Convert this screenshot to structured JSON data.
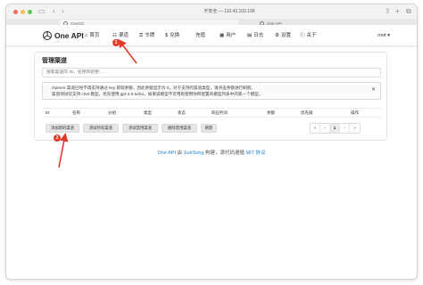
{
  "browser": {
    "address": "不安全 — 110.42.103.199",
    "tabs": [
      {
        "label": "OneOS"
      },
      {
        "label": "One API"
      }
    ]
  },
  "header": {
    "brand": "One API",
    "nav": [
      {
        "label": "首页",
        "icon": "home-icon",
        "glyph": "⌂"
      },
      {
        "label": "渠道",
        "icon": "sitemap-icon",
        "glyph": "☷"
      },
      {
        "label": "令牌",
        "icon": "key-icon",
        "glyph": "⚿"
      },
      {
        "label": "兑换",
        "icon": "dollar-icon",
        "glyph": "$"
      },
      {
        "label": "充值",
        "icon": "cart-icon",
        "glyph": ""
      },
      {
        "label": "用户",
        "icon": "user-icon",
        "glyph": "▦"
      },
      {
        "label": "日志",
        "icon": "book-icon",
        "glyph": "▤"
      },
      {
        "label": "设置",
        "icon": "gear-icon",
        "glyph": "⚙"
      },
      {
        "label": "关于",
        "icon": "info-icon",
        "glyph": "ⓘ"
      }
    ],
    "user": "root"
  },
  "page": {
    "title": "管理渠道",
    "search_placeholder": "搜索渠道的 ID，名称和密钥 ...",
    "alert_lines": [
      "OpenAI 渠道已经不再支持通过 key 获取余额，因此余额显示为 0。对于支持的渠道类型，请点击余额进行刷新。",
      "渠道测试仅支持 chat 模型，优先使用 gpt-3.5-turbo，如果该模型不可用则使用你所配置的模型列表中的第一个模型。"
    ],
    "alert_close": "✕",
    "columns": [
      "ID",
      "名称",
      "分组",
      "类型",
      "状态",
      "响应时间",
      "余额",
      "优先级",
      "操作"
    ],
    "buttons": [
      "添加新的渠道",
      "测试所有渠道",
      "测试禁用渠道",
      "删除禁用渠道",
      "刷新"
    ],
    "pager": [
      "«",
      "‹",
      "1",
      "›",
      "»"
    ]
  },
  "footer": {
    "link1": "One API",
    "text1": " 由 ",
    "link2": "JustSong",
    "text2": " 构建，源代码遵循 ",
    "link3": "MIT 协议"
  },
  "annotations": [
    "1",
    "2"
  ],
  "colors": {
    "accent_red": "#e23b2e",
    "link": "#2185d0"
  }
}
